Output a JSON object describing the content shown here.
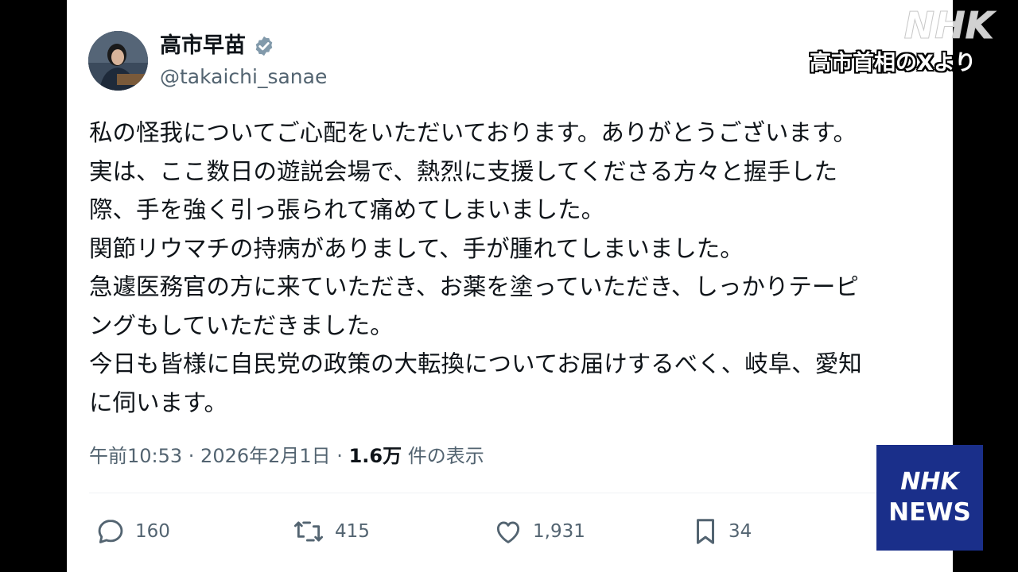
{
  "profile": {
    "display_name": "高市早苗",
    "handle": "@takaichi_sanae",
    "verified": true
  },
  "tweet": {
    "lines": [
      "私の怪我についてご心配をいただいております。ありがとうございます。",
      "実は、ここ数日の遊説会場で、熱烈に支援してくださる方々と握手した",
      "際、手を強く引っ張られて痛めてしまいました。",
      "関節リウマチの持病がありまして、手が腫れてしまいました。",
      "急遽医務官の方に来ていただき、お薬を塗っていただき、しっかりテーピ",
      "ングもしていただきました。",
      "今日も皆様に自民党の政策の大転換についてお届けするべく、岐阜、愛知",
      "に伺います。"
    ]
  },
  "meta": {
    "time_date": "午前10:53 · 2026年2月1日 · ",
    "views_count": "1.6万",
    "views_label": " 件の表示"
  },
  "actions": {
    "replies": "160",
    "retweets": "415",
    "likes": "1,931",
    "bookmarks": "34"
  },
  "overlay": {
    "caption": "高市首相のXより",
    "watermark_text": "NHK",
    "badge_line1": "NHK",
    "badge_line2": "NEWS"
  },
  "colors": {
    "text_primary": "#0f1419",
    "text_secondary": "#536471",
    "verified": "#829aab",
    "badge_bg": "#1a2f8a"
  }
}
